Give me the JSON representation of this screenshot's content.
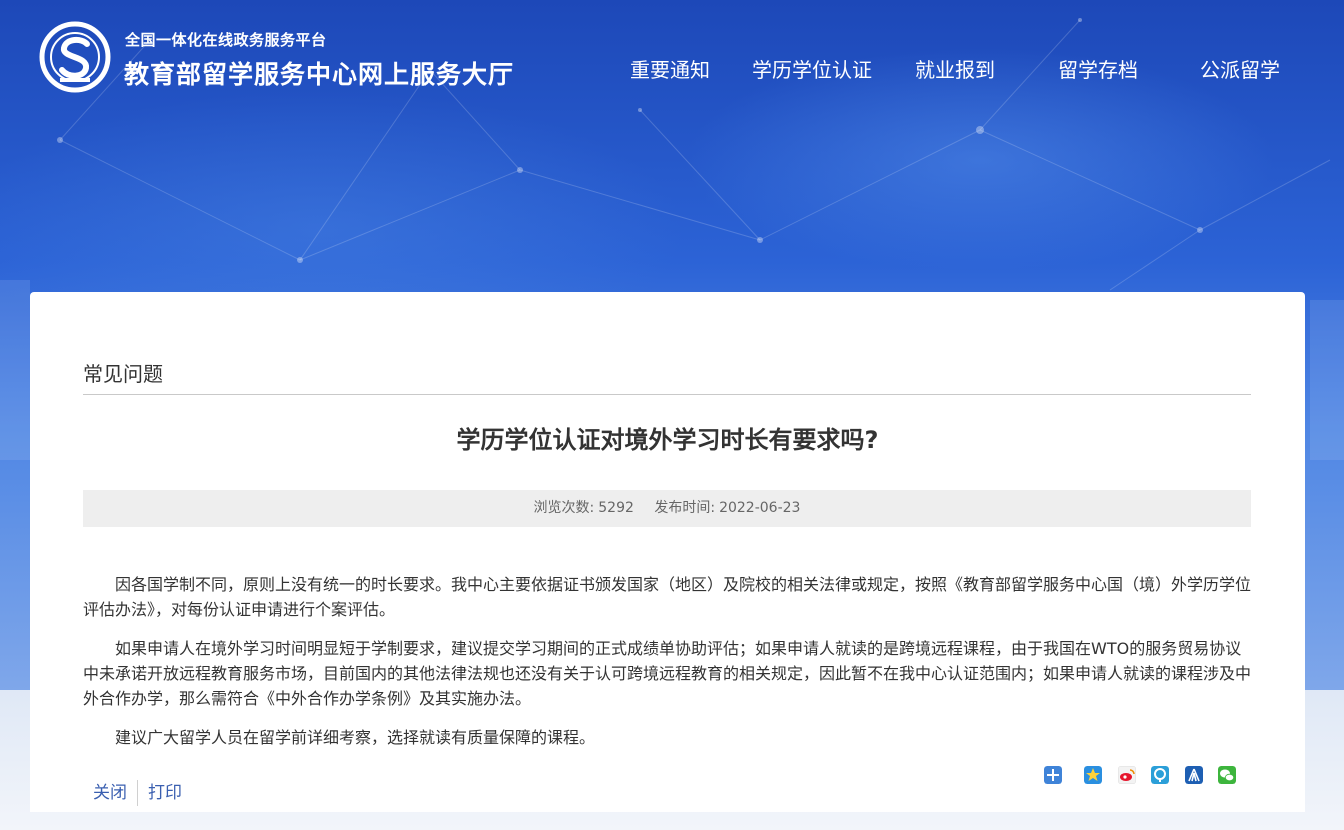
{
  "header": {
    "platform_name": "全国一体化在线政务服务平台",
    "site_name": "教育部留学服务中心网上服务大厅",
    "nav": [
      {
        "label": "重要通知"
      },
      {
        "label": "学历学位认证"
      },
      {
        "label": "就业报到"
      },
      {
        "label": "留学存档"
      },
      {
        "label": "公派留学"
      }
    ]
  },
  "content": {
    "section_title": "常见问题",
    "article_title": "学历学位认证对境外学习时长有要求吗?",
    "meta": {
      "views_label": "浏览次数:",
      "views": "5292",
      "date_label": "发布时间:",
      "date": "2022-06-23"
    },
    "paragraphs": [
      "因各国学制不同，原则上没有统一的时长要求。我中心主要依据证书颁发国家（地区）及院校的相关法律或规定，按照《教育部留学服务中心国（境）外学历学位评估办法》，对每份认证申请进行个案评估。",
      "如果申请人在境外学习时间明显短于学制要求，建议提交学习期间的正式成绩单协助评估；如果申请人就读的是跨境远程课程，由于我国在WTO的服务贸易协议中未承诺开放远程教育服务市场，目前国内的其他法律法规也还没有关于认可跨境远程教育的相关规定，因此暂不在我中心认证范围内；如果申请人就读的课程涉及中外合作办学，那么需符合《中外合作办学条例》及其实施办法。",
      "建议广大留学人员在留学前详细考察，选择就读有质量保障的课程。"
    ],
    "actions": {
      "close": "关闭",
      "print": "打印"
    }
  },
  "share": {
    "icons": [
      "share-more-icon",
      "qzone-icon",
      "weibo-icon",
      "tencent-weibo-icon",
      "renren-icon",
      "wechat-icon"
    ]
  },
  "colors": {
    "header_blue": "#1d48b8",
    "link_blue": "#3a5fb0",
    "meta_bg": "#eeeeee"
  }
}
